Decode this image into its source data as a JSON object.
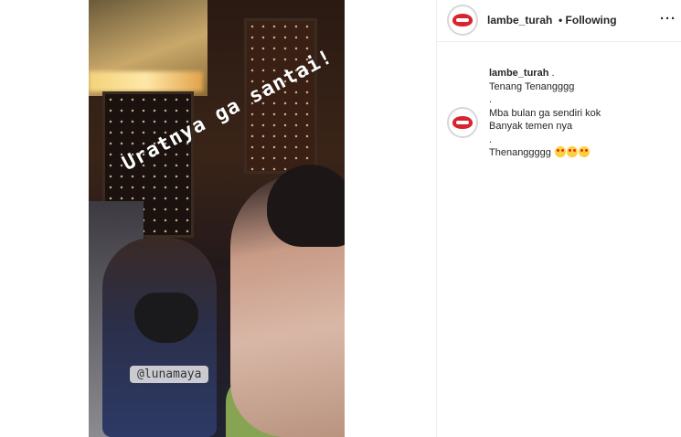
{
  "post": {
    "media": {
      "overlay_caption": "Uratnya ga santai!",
      "mention_tag": "@lunamaya"
    },
    "header": {
      "username": "lambe_turah",
      "separator_status": "• Following",
      "more_icon": "more-horizontal-icon"
    },
    "caption": {
      "username": "lambe_turah",
      "lines": [
        ".",
        "Tenang Tenangggg",
        ".",
        "Mba bulan ga sendiri kok",
        "Banyak temen nya",
        ".",
        "Thenanggggg"
      ],
      "emoji": [
        "heart-eyes-emoji",
        "heart-eyes-emoji",
        "heart-eyes-emoji"
      ]
    }
  },
  "colors": {
    "accent_red": "#d9232e",
    "border": "#efefef",
    "text": "#262626"
  }
}
